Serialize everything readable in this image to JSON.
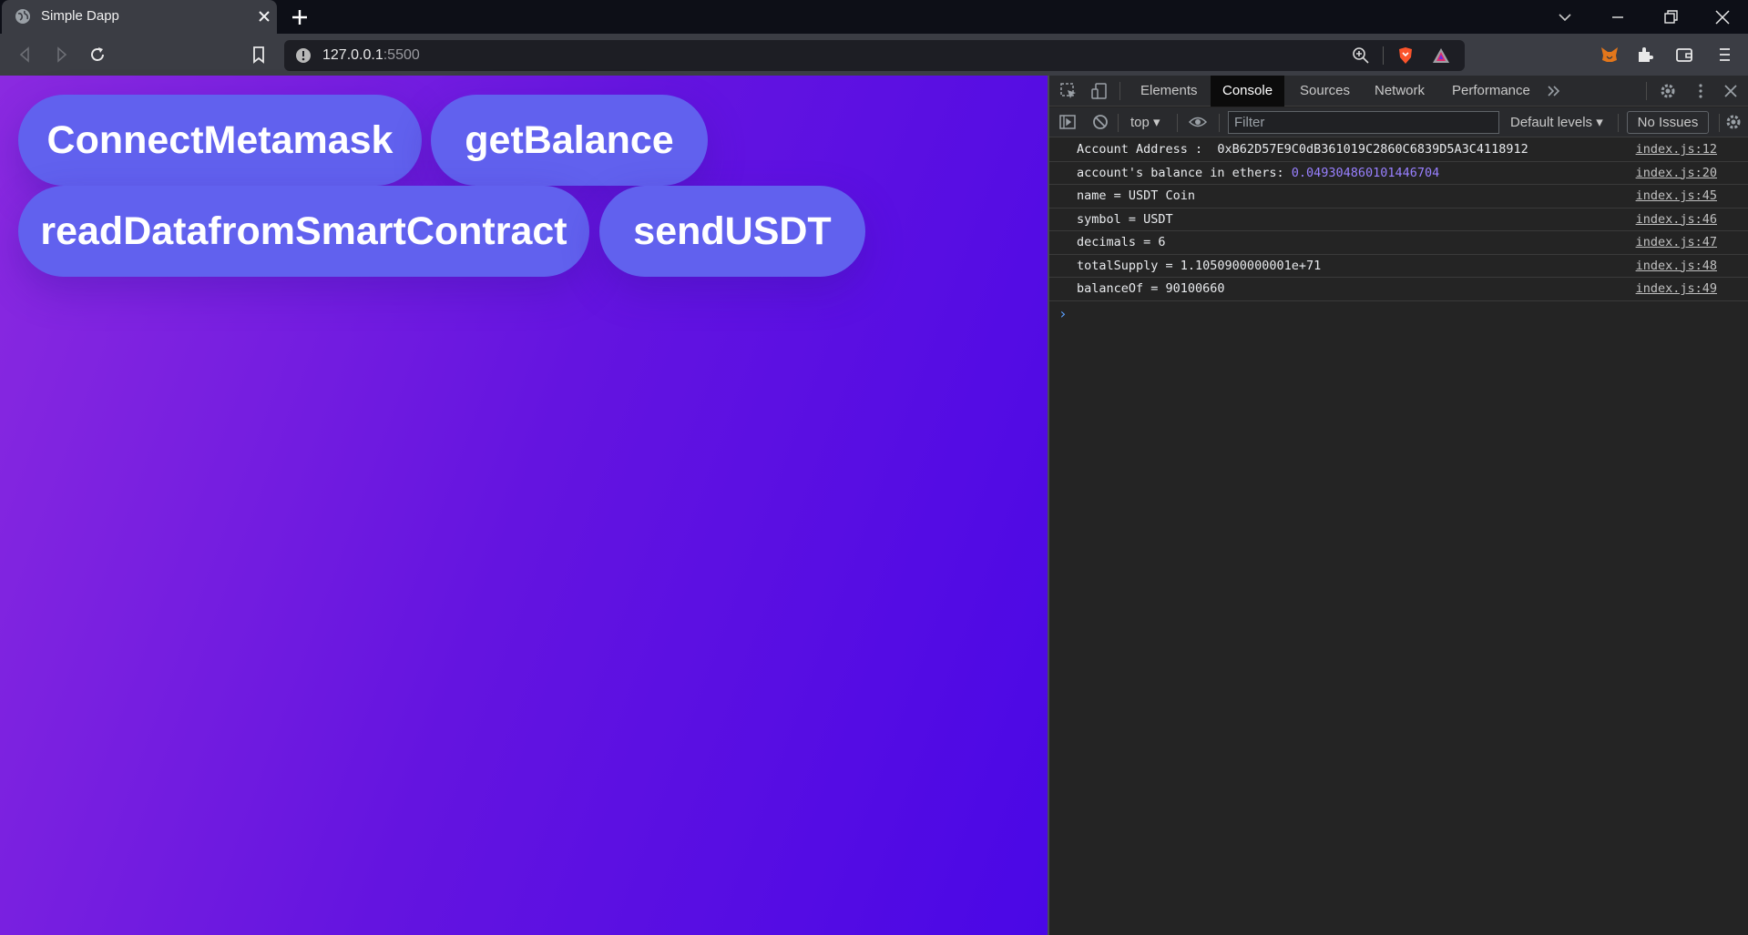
{
  "browser": {
    "tab_title": "Simple Dapp",
    "url_host": "127.0.0.1",
    "url_port": ":5500"
  },
  "page": {
    "buttons": [
      {
        "label": "ConnectMetamask"
      },
      {
        "label": "getBalance"
      },
      {
        "label": "readDatafromSmartContract"
      },
      {
        "label": "sendUSDT"
      }
    ],
    "gradient": [
      "#8b2ae0",
      "#4a07e6"
    ],
    "button_color": "#6161ee"
  },
  "devtools": {
    "tabs": [
      "Elements",
      "Console",
      "Sources",
      "Network",
      "Performance"
    ],
    "active_tab": "Console",
    "context": "top",
    "filter_placeholder": "Filter",
    "levels": "Default levels",
    "issues": "No Issues",
    "logs": [
      {
        "text": "Account Address :  0xB62D57E9C0dB361019C2860C6839D5A3C4118912",
        "value": "",
        "source": "index.js:12"
      },
      {
        "text": "account's balance in ethers: ",
        "value": "0.049304860101446704",
        "source": "index.js:20"
      },
      {
        "text": "name = USDT Coin",
        "value": "",
        "source": "index.js:45"
      },
      {
        "text": "symbol = USDT",
        "value": "",
        "source": "index.js:46"
      },
      {
        "text": "decimals = 6",
        "value": "",
        "source": "index.js:47"
      },
      {
        "text": "totalSupply = 1.1050900000001e+71",
        "value": "",
        "source": "index.js:48"
      },
      {
        "text": "balanceOf = 90100660",
        "value": "",
        "source": "index.js:49"
      }
    ],
    "prompt": "›"
  }
}
